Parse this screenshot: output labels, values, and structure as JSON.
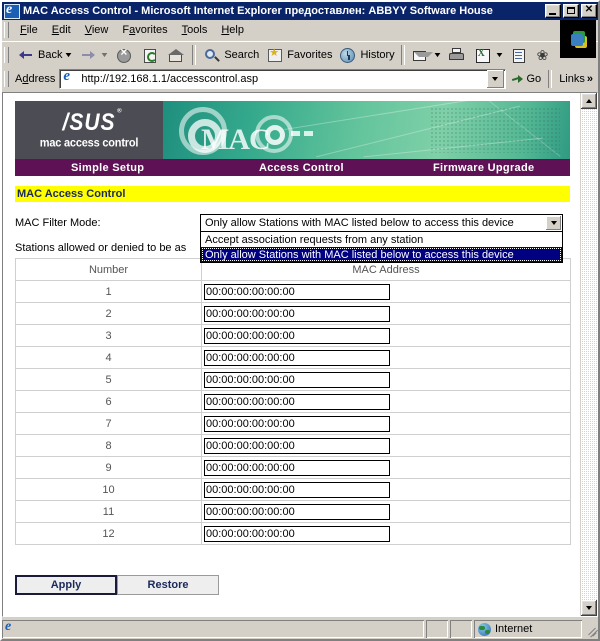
{
  "window": {
    "title": "MAC Access Control - Microsoft Internet Explorer предоставлен: ABBYY Software House",
    "title_icon": "ie-document-icon",
    "minimize_label": "_",
    "maximize_label": "",
    "close_label": "✕"
  },
  "menubar": {
    "items": [
      {
        "label": "File",
        "accel": "F"
      },
      {
        "label": "Edit",
        "accel": "E"
      },
      {
        "label": "View",
        "accel": "V"
      },
      {
        "label": "Favorites",
        "accel": "a"
      },
      {
        "label": "Tools",
        "accel": "T"
      },
      {
        "label": "Help",
        "accel": "H"
      }
    ]
  },
  "toolbar": {
    "back_label": "Back",
    "forward_label": "",
    "items": [
      {
        "name": "stop-icon",
        "label": ""
      },
      {
        "name": "refresh-icon",
        "label": ""
      },
      {
        "name": "home-icon",
        "label": ""
      },
      {
        "name": "search-icon",
        "label": "Search"
      },
      {
        "name": "favorites-icon",
        "label": "Favorites"
      },
      {
        "name": "history-icon",
        "label": "History"
      },
      {
        "name": "mail-icon",
        "label": ""
      },
      {
        "name": "print-icon",
        "label": ""
      },
      {
        "name": "edit-icon",
        "label": ""
      },
      {
        "name": "discuss-icon",
        "label": ""
      },
      {
        "name": "messenger-icon",
        "label": ""
      }
    ]
  },
  "address": {
    "label": "Address",
    "url": "http://192.168.1.1/accesscontrol.asp",
    "go_label": "Go",
    "links_label": "Links",
    "chevrons": "»"
  },
  "router": {
    "logo": {
      "brand": "/SUS",
      "subtitle": "mac access control",
      "art_text": "MAC"
    },
    "nav": [
      {
        "label": "Simple Setup"
      },
      {
        "label": "Access Control"
      },
      {
        "label": "Firmware Upgrade"
      }
    ],
    "section_title": "MAC Access Control",
    "filter_label": "MAC Filter Mode:",
    "filter_selected": "Only allow Stations with MAC listed below to access this device",
    "filter_options": [
      "Accept association requests from any station",
      "Only allow Stations with MAC listed below to access this device"
    ],
    "note": "Stations allowed or denied to be as",
    "table": {
      "headers": [
        "Number",
        "MAC Address"
      ],
      "rows": [
        {
          "number": "1",
          "mac": "00:00:00:00:00:00"
        },
        {
          "number": "2",
          "mac": "00:00:00:00:00:00"
        },
        {
          "number": "3",
          "mac": "00:00:00:00:00:00"
        },
        {
          "number": "4",
          "mac": "00:00:00:00:00:00"
        },
        {
          "number": "5",
          "mac": "00:00:00:00:00:00"
        },
        {
          "number": "6",
          "mac": "00:00:00:00:00:00"
        },
        {
          "number": "7",
          "mac": "00:00:00:00:00:00"
        },
        {
          "number": "8",
          "mac": "00:00:00:00:00:00"
        },
        {
          "number": "9",
          "mac": "00:00:00:00:00:00"
        },
        {
          "number": "10",
          "mac": "00:00:00:00:00:00"
        },
        {
          "number": "11",
          "mac": "00:00:00:00:00:00"
        },
        {
          "number": "12",
          "mac": "00:00:00:00:00:00"
        }
      ]
    },
    "apply_label": "Apply",
    "restore_label": "Restore"
  },
  "statusbar": {
    "message": "",
    "zone": "Internet"
  },
  "colors": {
    "titlebar": "#0a246a",
    "nav_purple": "#5e1154",
    "section_yellow": "#ffff00",
    "logo_gray": "#4c4c54",
    "banner_teal": "#35a98c",
    "selection_blue": "#000080"
  }
}
